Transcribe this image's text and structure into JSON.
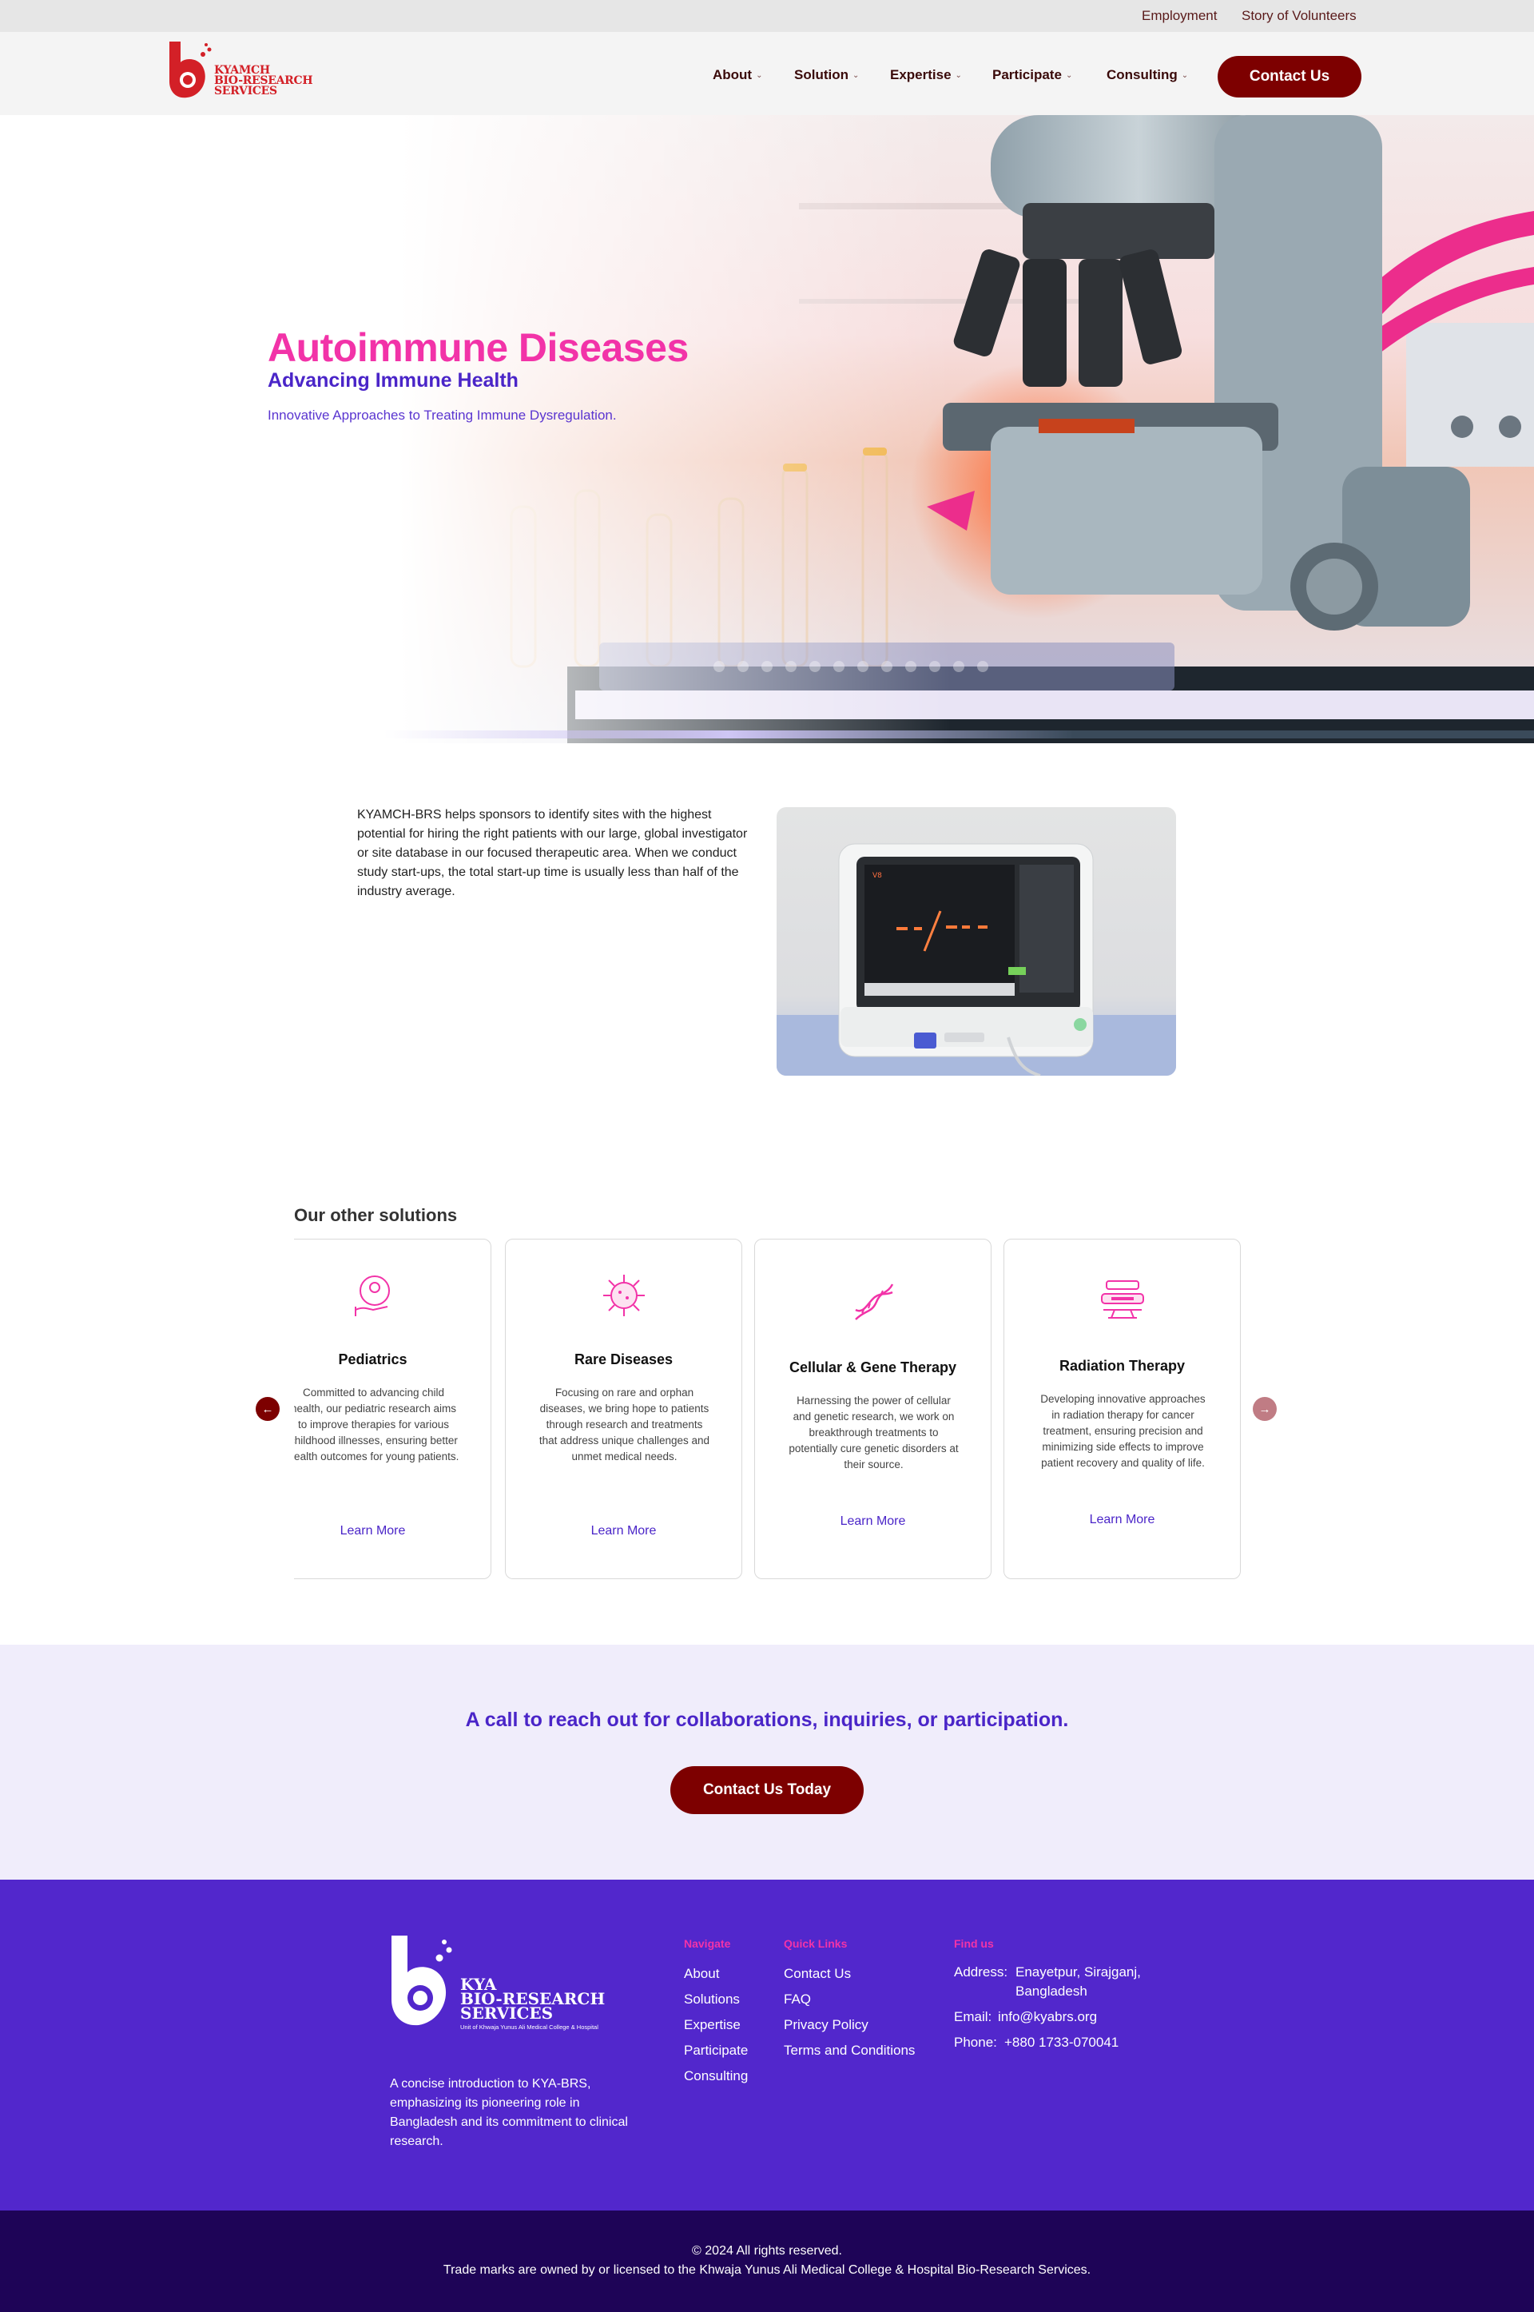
{
  "colors": {
    "brand_red": "#7d0000",
    "accent_pink": "#f233a8",
    "accent_purple": "#4a25c8",
    "footer_bg": "#5227cc",
    "footer_bottom_bg": "#1e0457",
    "cta_bg": "#f0edfb"
  },
  "topbar": {
    "links": [
      "Employment",
      "Story of Volunteers"
    ]
  },
  "header": {
    "logo_text": [
      "KYAMCH",
      "BIO-RESEARCH",
      "SERVICES"
    ],
    "nav": [
      {
        "label": "About",
        "icon": "chevron-down-icon"
      },
      {
        "label": "Solution",
        "icon": "chevron-down-icon"
      },
      {
        "label": "Expertise",
        "icon": "chevron-down-icon"
      },
      {
        "label": "Participate",
        "icon": "chevron-down-icon"
      },
      {
        "label": "Consulting",
        "icon": "chevron-down-icon"
      }
    ],
    "contact_label": "Contact Us"
  },
  "hero": {
    "title": "Autoimmune Diseases",
    "subtitle": "Advancing Immune Health",
    "description": "Innovative Approaches to Treating Immune Dysregulation."
  },
  "intro": {
    "text": "KYAMCH-BRS helps sponsors to identify sites with the highest potential for hiring the right patients with our large, global investigator or site database in our focused therapeutic area. When we conduct study start-ups, the total start-up time is usually less than half of the industry average.",
    "device_screen_label": "V8"
  },
  "solutions": {
    "heading": "Our other solutions",
    "cards": [
      {
        "icon": "child-hand-icon",
        "title": "Pediatrics",
        "description": "Committed to advancing child health, our pediatric research aims to improve therapies for various childhood illnesses, ensuring better health outcomes for young patients.",
        "link": "Learn More"
      },
      {
        "icon": "virus-icon",
        "title": "Rare Diseases",
        "description": "Focusing on rare and orphan diseases, we bring hope to patients through research and treatments that address unique challenges and unmet medical needs.",
        "link": "Learn More"
      },
      {
        "icon": "dna-icon",
        "title": "Cellular & Gene Therapy",
        "description": "Harnessing the power of cellular and genetic research, we work on breakthrough treatments to potentially cure genetic disorders at their source.",
        "link": "Learn More"
      },
      {
        "icon": "radiation-machine-icon",
        "title": "Radiation Therapy",
        "description": "Developing innovative approaches in radiation therapy for cancer treatment, ensuring precision and minimizing side effects to improve patient recovery and quality of life.",
        "link": "Learn More"
      }
    ]
  },
  "cta": {
    "text": "A call to reach out for collaborations, inquiries, or participation.",
    "button": "Contact Us Today"
  },
  "footer": {
    "logo_text": [
      "KYA",
      "BIO-RESEARCH",
      "SERVICES"
    ],
    "logo_tagline": "Unit of Khwaja Yunus Ali Medical College & Hospital",
    "about": "A concise introduction to KYA-BRS, emphasizing its pioneering role in Bangladesh and its commitment to clinical research.",
    "navigate": {
      "title": "Navigate",
      "links": [
        "About",
        "Solutions",
        "Expertise",
        "Participate",
        "Consulting"
      ]
    },
    "quick_links": {
      "title": "Quick Links",
      "links": [
        "Contact Us",
        "FAQ",
        "Privacy Policy",
        "Terms and Conditions"
      ]
    },
    "find_us": {
      "title": "Find us",
      "address_label": "Address:",
      "address_line1": "Enayetpur, Sirajganj,",
      "address_line2": "Bangladesh",
      "email_label": "Email:",
      "email": "info@kyabrs.org",
      "phone_label": "Phone:",
      "phone": "+880 1733-070041"
    },
    "copyright": "© 2024 All rights reserved.",
    "trademark": "Trade marks are owned by or licensed to the Khwaja Yunus Ali Medical College & Hospital Bio-Research Services."
  }
}
